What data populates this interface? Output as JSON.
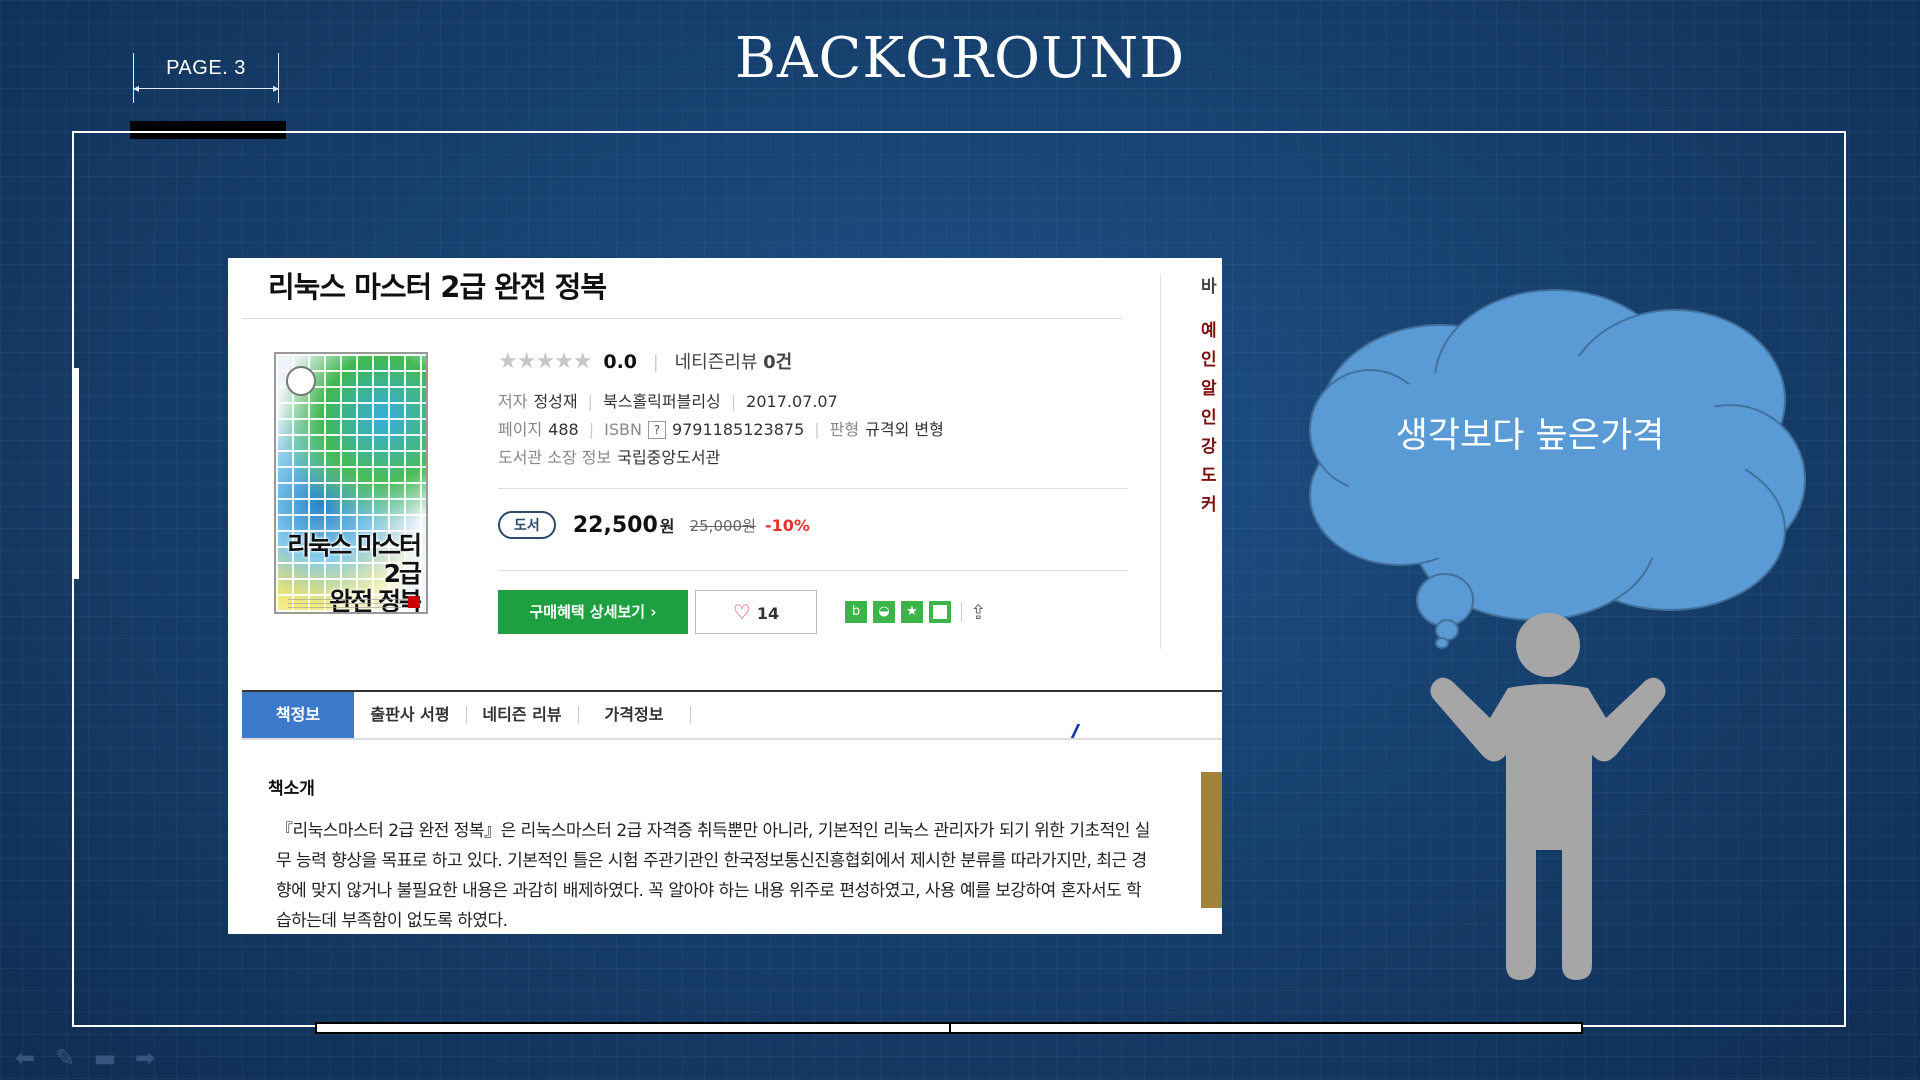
{
  "slide": {
    "page_label": "PAGE. 3",
    "title": "BACKGROUND",
    "thought": "생각보다 높은가격"
  },
  "screenshot": {
    "book_title": "리눅스 마스터 2급 완전 정복",
    "cover_title": "리눅스 마스터 2급\n완전 정복",
    "rating": {
      "stars": "★★★★★",
      "score": "0.0",
      "review_label": "네티즌리뷰",
      "review_count": "0건"
    },
    "author_label": "저자",
    "author": "정성재",
    "publisher": "북스홀릭퍼블리싱",
    "date": "2017.07.07",
    "pages_label": "페이지",
    "pages": "488",
    "isbn_label": "ISBN",
    "isbn_help": "?",
    "isbn": "9791185123875",
    "format_label": "판형",
    "format": "규격외 변형",
    "library_label": "도서관 소장 정보",
    "library": "국립중앙도서관",
    "price_tag": "도서",
    "price": "22,500",
    "price_unit": "원",
    "original_price": "25,000원",
    "discount": "-10%",
    "buy_button": "구매혜택 상세보기 ›",
    "like_count": "14",
    "side_items": [
      "바",
      "예",
      "인",
      "알",
      "인",
      "강",
      "도",
      "커"
    ],
    "tabs": [
      "책정보",
      "출판사 서평",
      "네티즌 리뷰",
      "가격정보"
    ],
    "intro_heading": "책소개",
    "intro_text": "『리눅스마스터 2급 완전 정복』은 리눅스마스터 2급 자격증 취득뿐만 아니라, 기본적인 리눅스 관리자가 되기 위한 기초적인 실무 능력 향상을 목표로 하고 있다. 기본적인 틀은 시험 주관기관인 한국정보통신진흥협회에서 제시한 분류를 따라가지만, 최근 경향에 맞지 않거나 불필요한 내용은 과감히 배제하였다. 꼭 알아야 하는 내용 위주로 편성하였고, 사용 예를 보강하여 혼자서도 학습하는데 부족함이 없도록 하였다."
  },
  "colors": {
    "background": "#17416f",
    "cloud": "#5b9bd5",
    "person": "#a6a6a6",
    "buy_button": "#1ea040",
    "active_tab": "#3c79c9",
    "discount": "#e53030"
  },
  "icons": [
    "back-arrow-icon",
    "pen-icon",
    "slides-icon",
    "forward-arrow-icon",
    "heart-icon",
    "share-icon"
  ]
}
